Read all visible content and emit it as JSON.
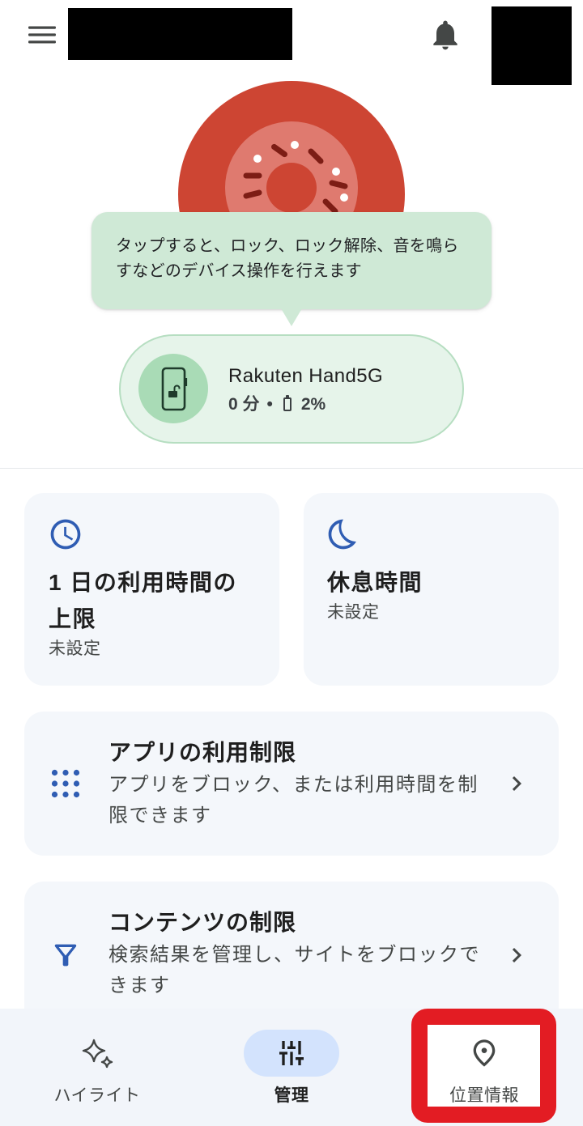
{
  "top_bar": {
    "menu_icon": "menu-icon",
    "notifications_icon": "bell-icon"
  },
  "tooltip": {
    "text": "タップすると、ロック、ロック解除、音を鳴らすなどのデバイス操作を行えます"
  },
  "device": {
    "name": "Rakuten Hand5G",
    "usage": "0 分",
    "separator": "•",
    "battery": "2%",
    "icon": "phone-unlocked-icon",
    "battery_icon": "battery-icon"
  },
  "cards": {
    "daily_limit": {
      "title": "1 日の利用時間の上限",
      "status": "未設定",
      "icon": "clock-icon"
    },
    "downtime": {
      "title": "休息時間",
      "status": "未設定",
      "icon": "moon-icon"
    },
    "app_limits": {
      "title": "アプリの利用制限",
      "description": "アプリをブロック、または利用時間を制限できます",
      "icon": "apps-grid-icon",
      "action_icon": "chevron-right-icon"
    },
    "content_restrictions": {
      "title": "コンテンツの制限",
      "description": "検索結果を管理し、サイトをブロックできます",
      "icon": "filter-icon",
      "action_icon": "chevron-right-icon"
    }
  },
  "bottom_nav": {
    "items": [
      {
        "label": "ハイライト",
        "icon": "sparkle-icon",
        "selected": false
      },
      {
        "label": "管理",
        "icon": "sliders-icon",
        "selected": true
      },
      {
        "label": "位置情報",
        "icon": "location-pin-icon",
        "selected": false
      }
    ]
  },
  "colors": {
    "avatar_red": "#cd4533",
    "donut_pink": "#df7a6f",
    "sprinkle_dark": "#7d1d15",
    "tooltip_green": "#cfe9d6",
    "device_pill_bg": "#e6f4ea",
    "device_pill_border": "#b6dec1",
    "device_icon_bg": "#a9dbb6",
    "card_bg": "#f4f7fb",
    "icon_blue": "#2f5db3",
    "nav_bg": "#f2f5fa",
    "nav_selected_pill": "#d3e3fd",
    "highlight_red": "#e31c23",
    "text_primary": "#1f1f1f",
    "text_secondary": "#444746"
  }
}
